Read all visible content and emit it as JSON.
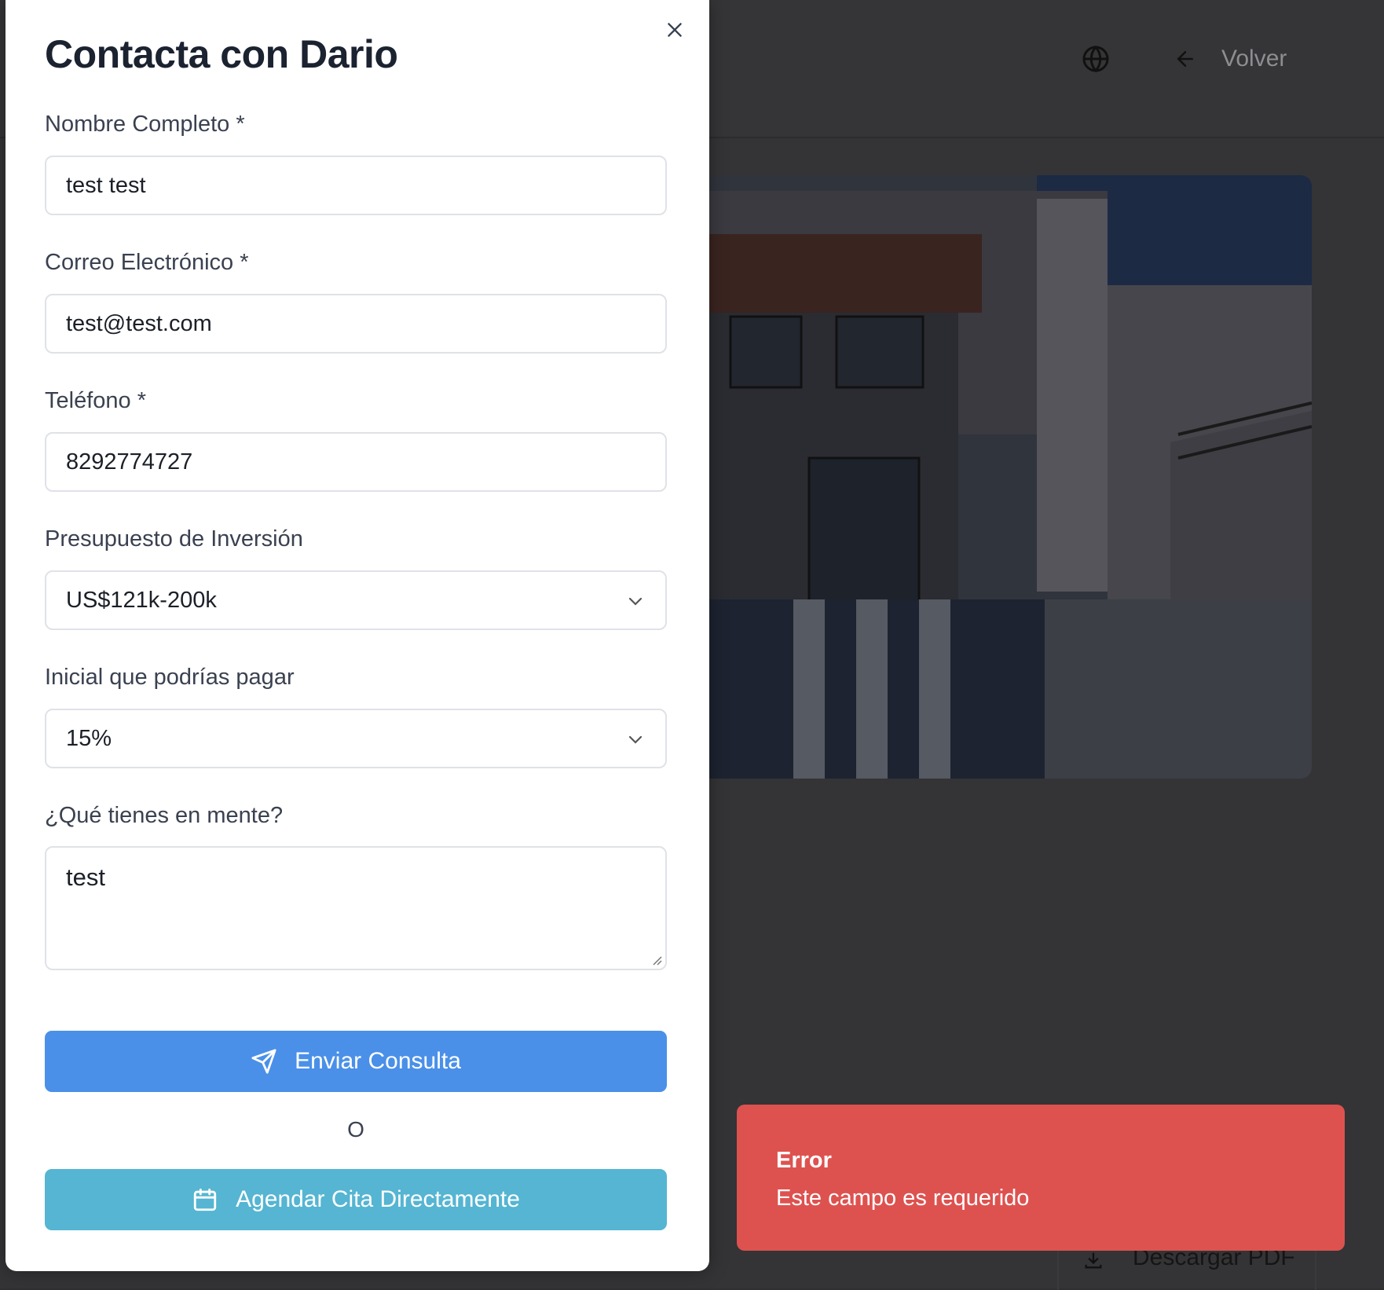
{
  "background": {
    "header": {
      "back_label": "Volver",
      "globe_icon": "globe-icon",
      "back_icon": "arrow-left-icon"
    },
    "download_label": "Descargar PDF"
  },
  "modal": {
    "title": "Contacta con Dario",
    "fields": {
      "name": {
        "label": "Nombre Completo *",
        "value": "test test"
      },
      "email": {
        "label": "Correo Electrónico *",
        "value": "test@test.com"
      },
      "phone": {
        "label": "Teléfono *",
        "value": "8292774727"
      },
      "budget": {
        "label": "Presupuesto de Inversión",
        "value": "US$121k-200k"
      },
      "down_payment": {
        "label": "Inicial que podrías pagar",
        "value": "15%"
      },
      "message": {
        "label": "¿Qué tienes en mente?",
        "value": "test"
      }
    },
    "send_label": "Enviar Consulta",
    "or_label": "O",
    "schedule_label": "Agendar Cita Directamente"
  },
  "toast": {
    "title": "Error",
    "message": "Este campo es requerido"
  },
  "colors": {
    "primary": "#4a90e8",
    "secondary": "#55b5d2",
    "error": "#dd524f"
  }
}
